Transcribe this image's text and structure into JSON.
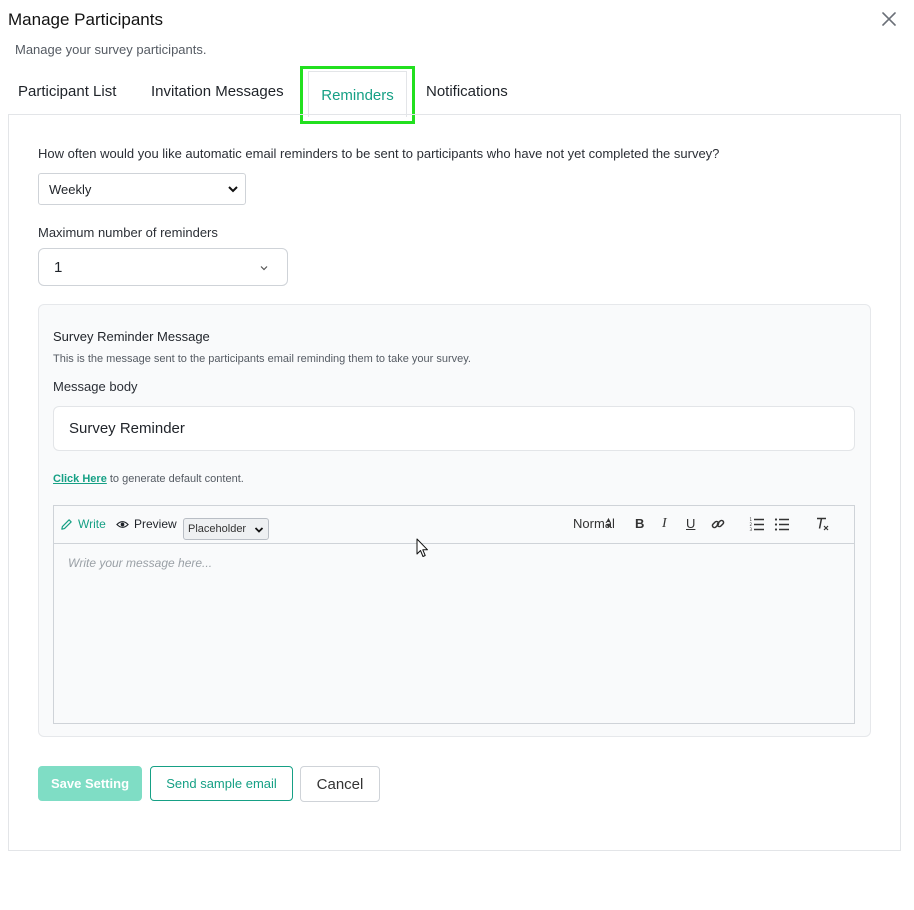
{
  "modal": {
    "title": "Manage Participants",
    "subtitle": "Manage your survey participants."
  },
  "tabs": [
    {
      "label": "Participant List"
    },
    {
      "label": "Invitation Messages"
    },
    {
      "label": "Reminders"
    },
    {
      "label": "Notifications"
    }
  ],
  "active_tab": "Reminders",
  "reminders": {
    "frequency_question": "How often would you like automatic email reminders to be sent to participants who have not yet completed the survey?",
    "frequency_value": "Weekly",
    "max_label": "Maximum number of reminders",
    "max_value": "1"
  },
  "message_card": {
    "title": "Survey Reminder Message",
    "description": "This is the message sent to the participants email reminding them to take your survey.",
    "body_label": "Message body",
    "subject_value": "Survey Reminder",
    "generate_link": "Click Here",
    "generate_text": " to generate default content."
  },
  "editor": {
    "write_label": "Write",
    "preview_label": "Preview",
    "placeholder_select": "Placeholder",
    "format_select": "Normal",
    "bold": "B",
    "italic": "I",
    "underline": "U",
    "placeholder_text": "Write your message here..."
  },
  "buttons": {
    "save": "Save Setting",
    "sample": "Send sample email",
    "cancel": "Cancel"
  },
  "colors": {
    "accent": "#16a085",
    "accent_disabled": "#7fddc5",
    "highlight": "#22e01f"
  }
}
